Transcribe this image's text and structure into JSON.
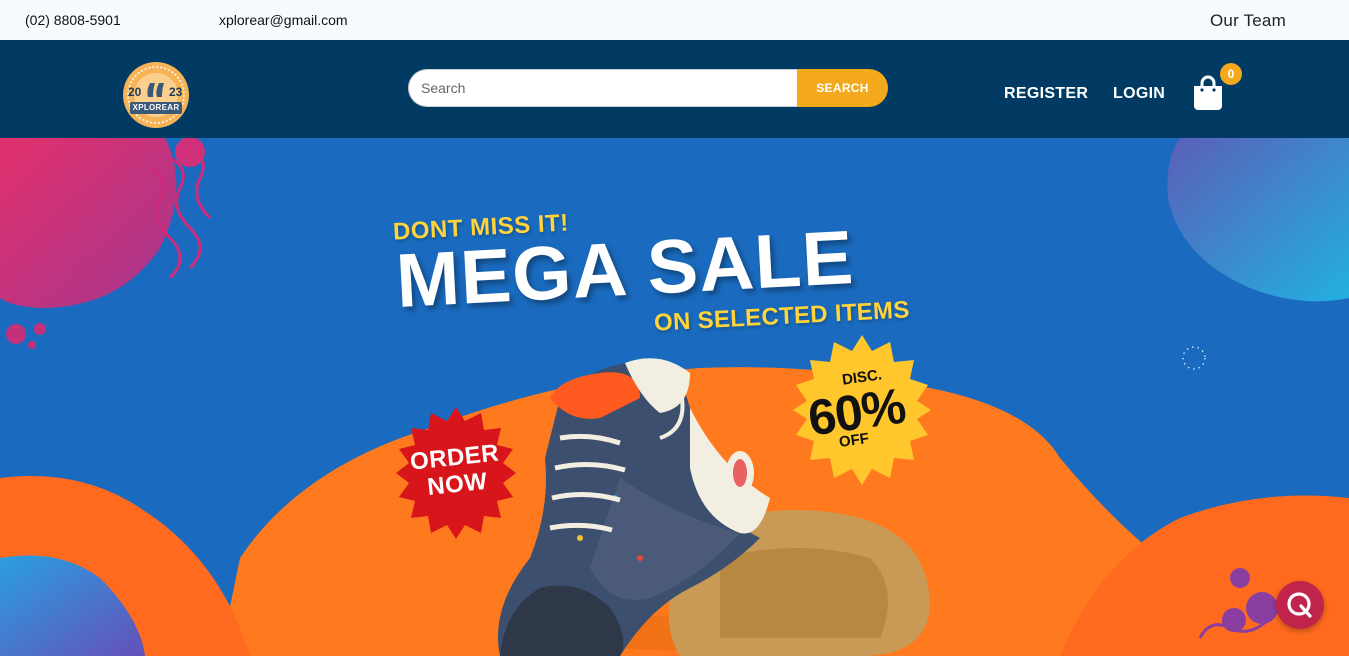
{
  "topbar": {
    "phone": "(02) 8808-5901",
    "email": "xplorear@gmail.com",
    "team_link": "Our Team"
  },
  "header": {
    "logo": {
      "year_left": "20",
      "year_right": "23",
      "brand": "XPLOREAR"
    },
    "search": {
      "placeholder": "Search",
      "value": "",
      "button_label": "SEARCH"
    },
    "nav": {
      "register": "REGISTER",
      "login": "LOGIN"
    },
    "cart": {
      "count": "0"
    }
  },
  "hero": {
    "tagline": "DONT MISS IT!",
    "headline": "MEGA SALE",
    "subline": "ON SELECTED ITEMS",
    "order_badge": {
      "line1": "ORDER",
      "line2": "NOW"
    },
    "discount_badge": {
      "top": "DISC.",
      "value": "60%",
      "bottom": "OFF"
    }
  },
  "colors": {
    "navbar": "#013b63",
    "accent": "#f4a81c",
    "hero_blue": "#1a6bbf",
    "hero_orange": "#ff7a1f",
    "badge_red": "#d7151b",
    "badge_yellow": "#ffc72c"
  },
  "icons": {
    "cart": "shopping-bag-icon",
    "chat": "chat-bubble-icon"
  }
}
